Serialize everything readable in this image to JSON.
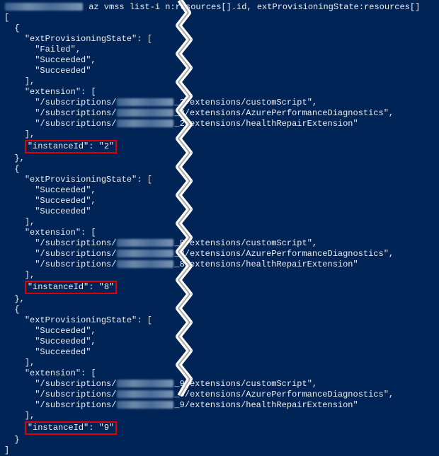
{
  "command": "az vmss list-i  n:resources[].id, extProvisioningState:resources[]",
  "opening_bracket": "[",
  "closing_bracket": "]",
  "instances": [
    {
      "extProvisioningState": [
        "Failed",
        "Succeeded",
        "Succeeded"
      ],
      "extensionPrefix": "/subscriptions/",
      "extensionSuffixes": [
        "_2/extensions/customScript",
        "_2/extensions/AzurePerformanceDiagnostics",
        "_2/extensions/healthRepairExtension"
      ],
      "instanceIdLine": "\"instanceId\": \"2\""
    },
    {
      "extProvisioningState": [
        "Succeeded",
        "Succeeded",
        "Succeeded"
      ],
      "extensionPrefix": "/subscriptions/",
      "extensionSuffixes": [
        "_8/extensions/customScript",
        "_8/extensions/AzurePerformanceDiagnostics",
        "_8/extensions/healthRepairExtension"
      ],
      "instanceIdLine": "\"instanceId\": \"8\""
    },
    {
      "extProvisioningState": [
        "Succeeded",
        "Succeeded",
        "Succeeded"
      ],
      "extensionPrefix": "/subscriptions/",
      "extensionSuffixes": [
        "_9/extensions/customScript",
        "_9/extensions/AzurePerformanceDiagnostics",
        "_9/extensions/healthRepairExtension"
      ],
      "instanceIdLine": "\"instanceId\": \"9\""
    }
  ],
  "keys": {
    "extProvisioningState": "\"extProvisioningState\": [",
    "extension": "\"extension\": [",
    "closeArr": "],"
  }
}
